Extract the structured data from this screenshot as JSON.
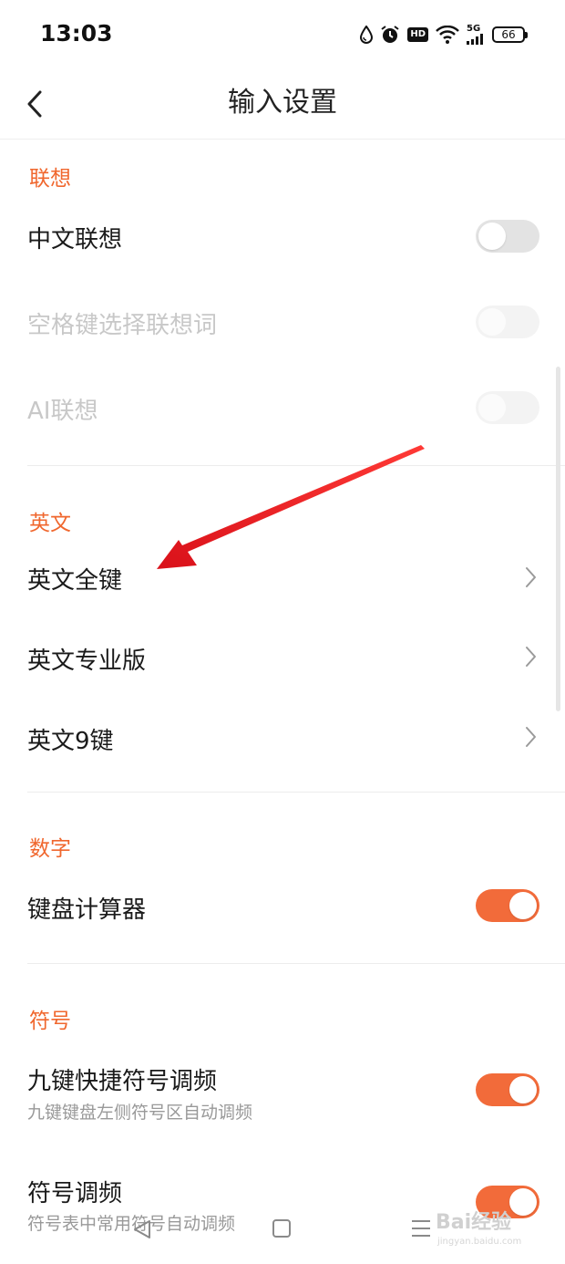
{
  "status_bar": {
    "time": "13:03",
    "icons": [
      "drop-icon",
      "alarm-icon",
      "hd-icon",
      "wifi-icon",
      "signal-5g-icon",
      "battery-icon"
    ],
    "hd_label": "HD",
    "network_label": "5G",
    "battery_level": "66"
  },
  "header": {
    "title": "输入设置",
    "back_icon": "chevron-left-icon"
  },
  "sections": {
    "association": {
      "title": "联想",
      "items": [
        {
          "label": "中文联想",
          "type": "toggle",
          "on": false,
          "enabled": true
        },
        {
          "label": "空格键选择联想词",
          "type": "toggle",
          "on": false,
          "enabled": false
        },
        {
          "label": "AI联想",
          "type": "toggle",
          "on": false,
          "enabled": false
        }
      ]
    },
    "english": {
      "title": "英文",
      "items": [
        {
          "label": "英文全键",
          "type": "link"
        },
        {
          "label": "英文专业版",
          "type": "link"
        },
        {
          "label": "英文9键",
          "type": "link"
        }
      ]
    },
    "number": {
      "title": "数字",
      "items": [
        {
          "label": "键盘计算器",
          "type": "toggle",
          "on": true,
          "enabled": true
        }
      ]
    },
    "symbol": {
      "title": "符号",
      "items": [
        {
          "label": "九键快捷符号调频",
          "sub": "九键键盘左侧符号区自动调频",
          "type": "toggle",
          "on": true,
          "enabled": true
        },
        {
          "label": "符号调频",
          "sub": "符号表中常用符号自动调频",
          "type": "toggle",
          "on": true,
          "enabled": true
        }
      ]
    }
  },
  "system_nav": {
    "icons": [
      "back-triangle-icon",
      "home-square-icon",
      "menu-lines-icon"
    ]
  },
  "watermark": {
    "text": "Bai经验",
    "sub": "jingyan.baidu.com"
  },
  "colors": {
    "accent": "#f26b3a",
    "section_title": "#f0672e",
    "annotation_arrow": "#e8161a",
    "toggle_off": "#e3e3e3"
  }
}
